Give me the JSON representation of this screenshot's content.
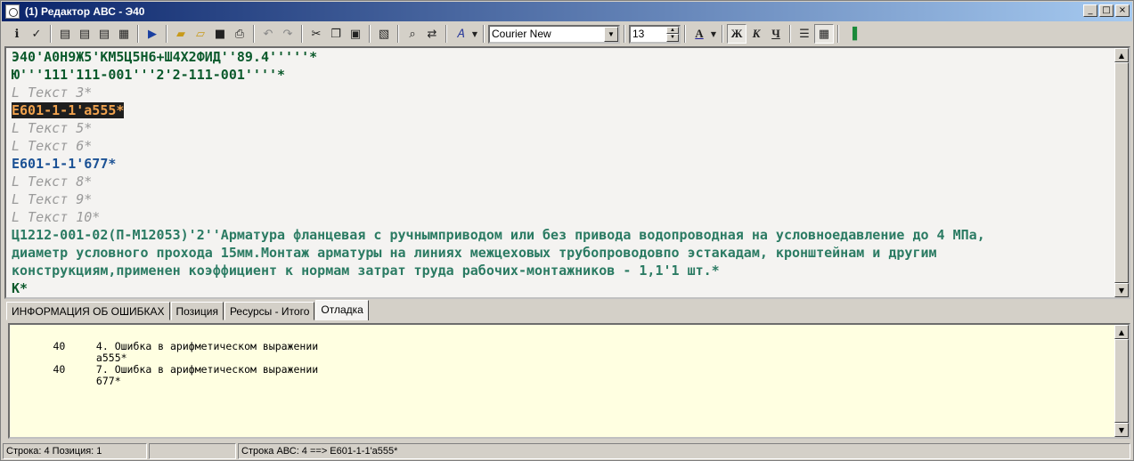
{
  "window": {
    "title": "(1) Редактор АВС - Э40",
    "buttons": [
      "_",
      "□",
      "×"
    ]
  },
  "toolbar": {
    "font_name": "Courier New",
    "font_size": "13",
    "bold_label": "Ж",
    "italic_label": "К",
    "underline_label": "Ч",
    "color_label": "A"
  },
  "editor": {
    "lines": [
      "Э40'А0Н9Ж5'КМ5Ц5Н6+Ш4Х2ФИД''89.4'''''*",
      "Ю'''111'111-001'''2'2-111-001''''*",
      "L Текст 3*",
      "Е601-1-1'а555*",
      "L Текст 5*",
      "L Текст 6*",
      "Е601-1-1'677*",
      "L Текст 8*",
      "L Текст 9*",
      "L Текст 10*",
      "Ц1212-001-02(П-М12053)'2''Арматура фланцевая с ручнымприводом или без привода водопроводная на условноедавление до 4 МПа,",
      "диаметр условного прохода 15мм.Монтаж арматуры на линиях межцеховых трубопроводовпо эстакадам, кронштейнам и другим",
      "конструкциям,применен коэффициент к нормам затрат труда рабочих-монтажников - 1,1'1 шт.*",
      "К*"
    ]
  },
  "tabs": [
    "ИНФОРМАЦИЯ ОБ ОШИБКАХ",
    "Позиция",
    "Ресурсы - Итого",
    "Отладка"
  ],
  "debug": {
    "text": "       40     4. Ошибка в арифметическом выражении\n              а555*\n       40     7. Ошибка в арифметическом выражении\n              677*"
  },
  "status": {
    "row_label": "Строка:  4  Позиция:  1",
    "empty": "",
    "abc_line": "Строка АВС:  4 ==> Е601-1-1'а555*"
  }
}
